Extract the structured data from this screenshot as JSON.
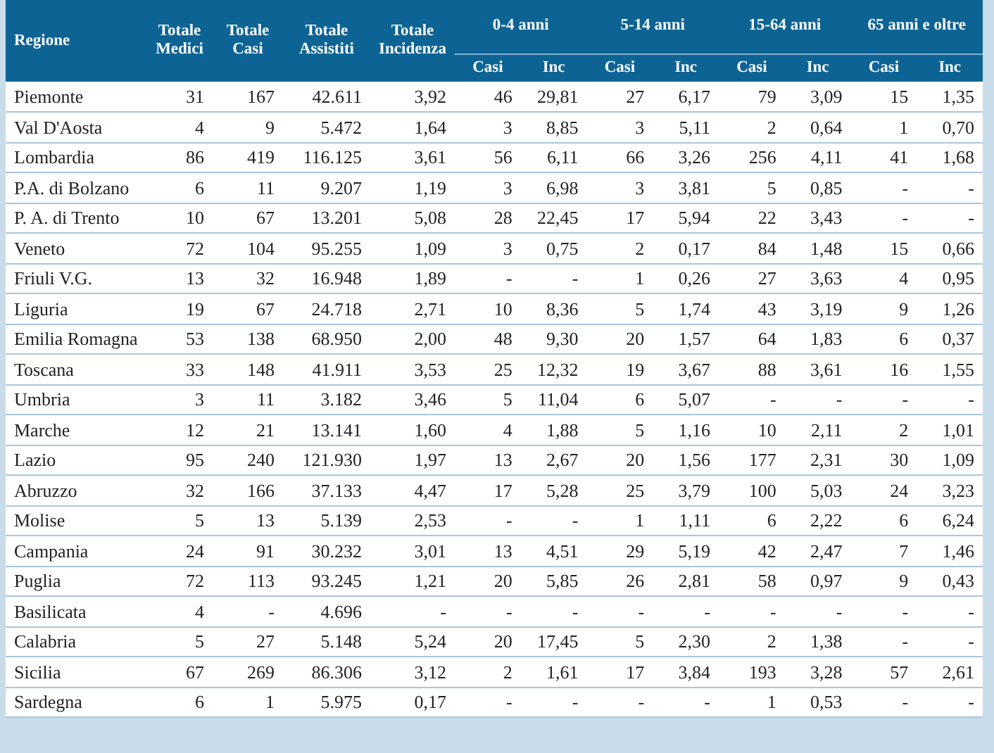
{
  "table": {
    "columns": [
      {
        "label": "Regione"
      },
      {
        "label": "Totale Medici"
      },
      {
        "label": "Totale Casi"
      },
      {
        "label": "Totale Assistiti"
      },
      {
        "label": "Totale Incidenza"
      }
    ],
    "age_groups": [
      {
        "label": "0-4 anni",
        "subcolumns": [
          "Casi",
          "Inc"
        ]
      },
      {
        "label": "5-14 anni",
        "subcolumns": [
          "Casi",
          "Inc"
        ]
      },
      {
        "label": "15-64 anni",
        "subcolumns": [
          "Casi",
          "Inc"
        ]
      },
      {
        "label": "65 anni e oltre",
        "subcolumns": [
          "Casi",
          "Inc"
        ]
      }
    ],
    "rows": [
      {
        "region": "Piemonte",
        "values": [
          "31",
          "167",
          "42.611",
          "3,92",
          "46",
          "29,81",
          "27",
          "6,17",
          "79",
          "3,09",
          "15",
          "1,35"
        ]
      },
      {
        "region": "Val D'Aosta",
        "values": [
          "4",
          "9",
          "5.472",
          "1,64",
          "3",
          "8,85",
          "3",
          "5,11",
          "2",
          "0,64",
          "1",
          "0,70"
        ]
      },
      {
        "region": "Lombardia",
        "values": [
          "86",
          "419",
          "116.125",
          "3,61",
          "56",
          "6,11",
          "66",
          "3,26",
          "256",
          "4,11",
          "41",
          "1,68"
        ]
      },
      {
        "region": "P.A. di Bolzano",
        "values": [
          "6",
          "11",
          "9.207",
          "1,19",
          "3",
          "6,98",
          "3",
          "3,81",
          "5",
          "0,85",
          "-",
          "-"
        ]
      },
      {
        "region": "P. A. di Trento",
        "values": [
          "10",
          "67",
          "13.201",
          "5,08",
          "28",
          "22,45",
          "17",
          "5,94",
          "22",
          "3,43",
          "-",
          "-"
        ]
      },
      {
        "region": "Veneto",
        "values": [
          "72",
          "104",
          "95.255",
          "1,09",
          "3",
          "0,75",
          "2",
          "0,17",
          "84",
          "1,48",
          "15",
          "0,66"
        ]
      },
      {
        "region": "Friuli V.G.",
        "values": [
          "13",
          "32",
          "16.948",
          "1,89",
          "-",
          "-",
          "1",
          "0,26",
          "27",
          "3,63",
          "4",
          "0,95"
        ]
      },
      {
        "region": "Liguria",
        "values": [
          "19",
          "67",
          "24.718",
          "2,71",
          "10",
          "8,36",
          "5",
          "1,74",
          "43",
          "3,19",
          "9",
          "1,26"
        ]
      },
      {
        "region": "Emilia Romagna",
        "values": [
          "53",
          "138",
          "68.950",
          "2,00",
          "48",
          "9,30",
          "20",
          "1,57",
          "64",
          "1,83",
          "6",
          "0,37"
        ]
      },
      {
        "region": "Toscana",
        "values": [
          "33",
          "148",
          "41.911",
          "3,53",
          "25",
          "12,32",
          "19",
          "3,67",
          "88",
          "3,61",
          "16",
          "1,55"
        ]
      },
      {
        "region": "Umbria",
        "values": [
          "3",
          "11",
          "3.182",
          "3,46",
          "5",
          "11,04",
          "6",
          "5,07",
          "-",
          "-",
          "-",
          "-"
        ]
      },
      {
        "region": "Marche",
        "values": [
          "12",
          "21",
          "13.141",
          "1,60",
          "4",
          "1,88",
          "5",
          "1,16",
          "10",
          "2,11",
          "2",
          "1,01"
        ]
      },
      {
        "region": "Lazio",
        "values": [
          "95",
          "240",
          "121.930",
          "1,97",
          "13",
          "2,67",
          "20",
          "1,56",
          "177",
          "2,31",
          "30",
          "1,09"
        ]
      },
      {
        "region": "Abruzzo",
        "values": [
          "32",
          "166",
          "37.133",
          "4,47",
          "17",
          "5,28",
          "25",
          "3,79",
          "100",
          "5,03",
          "24",
          "3,23"
        ]
      },
      {
        "region": "Molise",
        "values": [
          "5",
          "13",
          "5.139",
          "2,53",
          "-",
          "-",
          "1",
          "1,11",
          "6",
          "2,22",
          "6",
          "6,24"
        ]
      },
      {
        "region": "Campania",
        "values": [
          "24",
          "91",
          "30.232",
          "3,01",
          "13",
          "4,51",
          "29",
          "5,19",
          "42",
          "2,47",
          "7",
          "1,46"
        ]
      },
      {
        "region": "Puglia",
        "values": [
          "72",
          "113",
          "93.245",
          "1,21",
          "20",
          "5,85",
          "26",
          "2,81",
          "58",
          "0,97",
          "9",
          "0,43"
        ]
      },
      {
        "region": "Basilicata",
        "values": [
          "4",
          "-",
          "4.696",
          "-",
          "-",
          "-",
          "-",
          "-",
          "-",
          "-",
          "-",
          "-"
        ]
      },
      {
        "region": "Calabria",
        "values": [
          "5",
          "27",
          "5.148",
          "5,24",
          "20",
          "17,45",
          "5",
          "2,30",
          "2",
          "1,38",
          "-",
          "-"
        ]
      },
      {
        "region": "Sicilia",
        "values": [
          "67",
          "269",
          "86.306",
          "3,12",
          "2",
          "1,61",
          "17",
          "3,84",
          "193",
          "3,28",
          "57",
          "2,61"
        ]
      },
      {
        "region": "Sardegna",
        "values": [
          "6",
          "1",
          "5.975",
          "0,17",
          "-",
          "-",
          "-",
          "-",
          "1",
          "0,53",
          "-",
          "-"
        ]
      }
    ]
  }
}
